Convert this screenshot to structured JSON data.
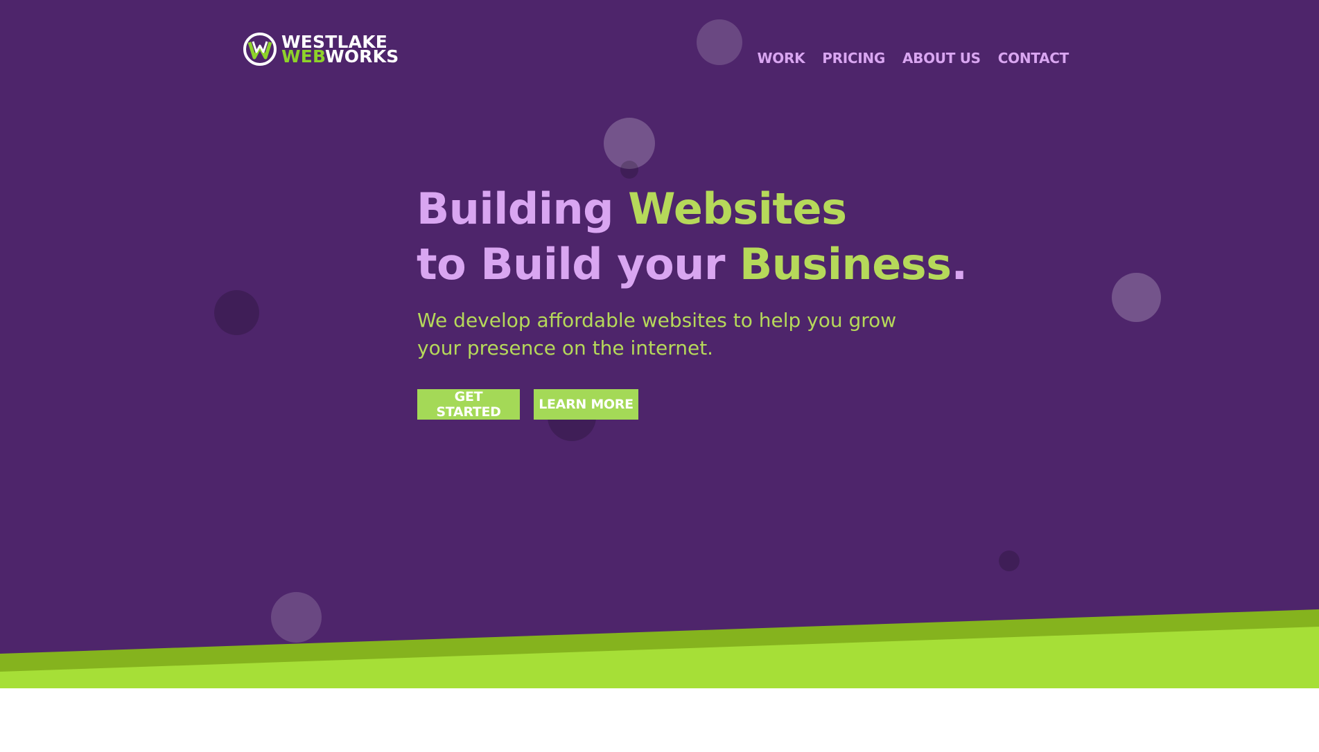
{
  "brand": {
    "line1": "WESTLAKE",
    "line2_accent": "WEB",
    "line2_rest": "WORKS",
    "logo_icon": "w-emblem-icon"
  },
  "nav": {
    "items": [
      "WORK",
      "PRICING",
      "ABOUT US",
      "CONTACT"
    ]
  },
  "hero": {
    "headline_line1_a": "Building ",
    "headline_line1_b": "Websites",
    "headline_line2_a": "to Build your ",
    "headline_line2_b": "Business",
    "headline_line2_c": ".",
    "subtitle": "We develop affordable websites to help you grow your presence on the internet.",
    "primary_button": "GET STARTED",
    "secondary_button": "LEARN MORE"
  },
  "colors": {
    "background": "#4e256b",
    "nav_text": "#d9a6f1",
    "headline": "#d9a6f1",
    "accent": "#b6d95a",
    "button": "#a4d957",
    "wedge_dark": "#85b31e",
    "wedge_light": "#a6df37"
  }
}
